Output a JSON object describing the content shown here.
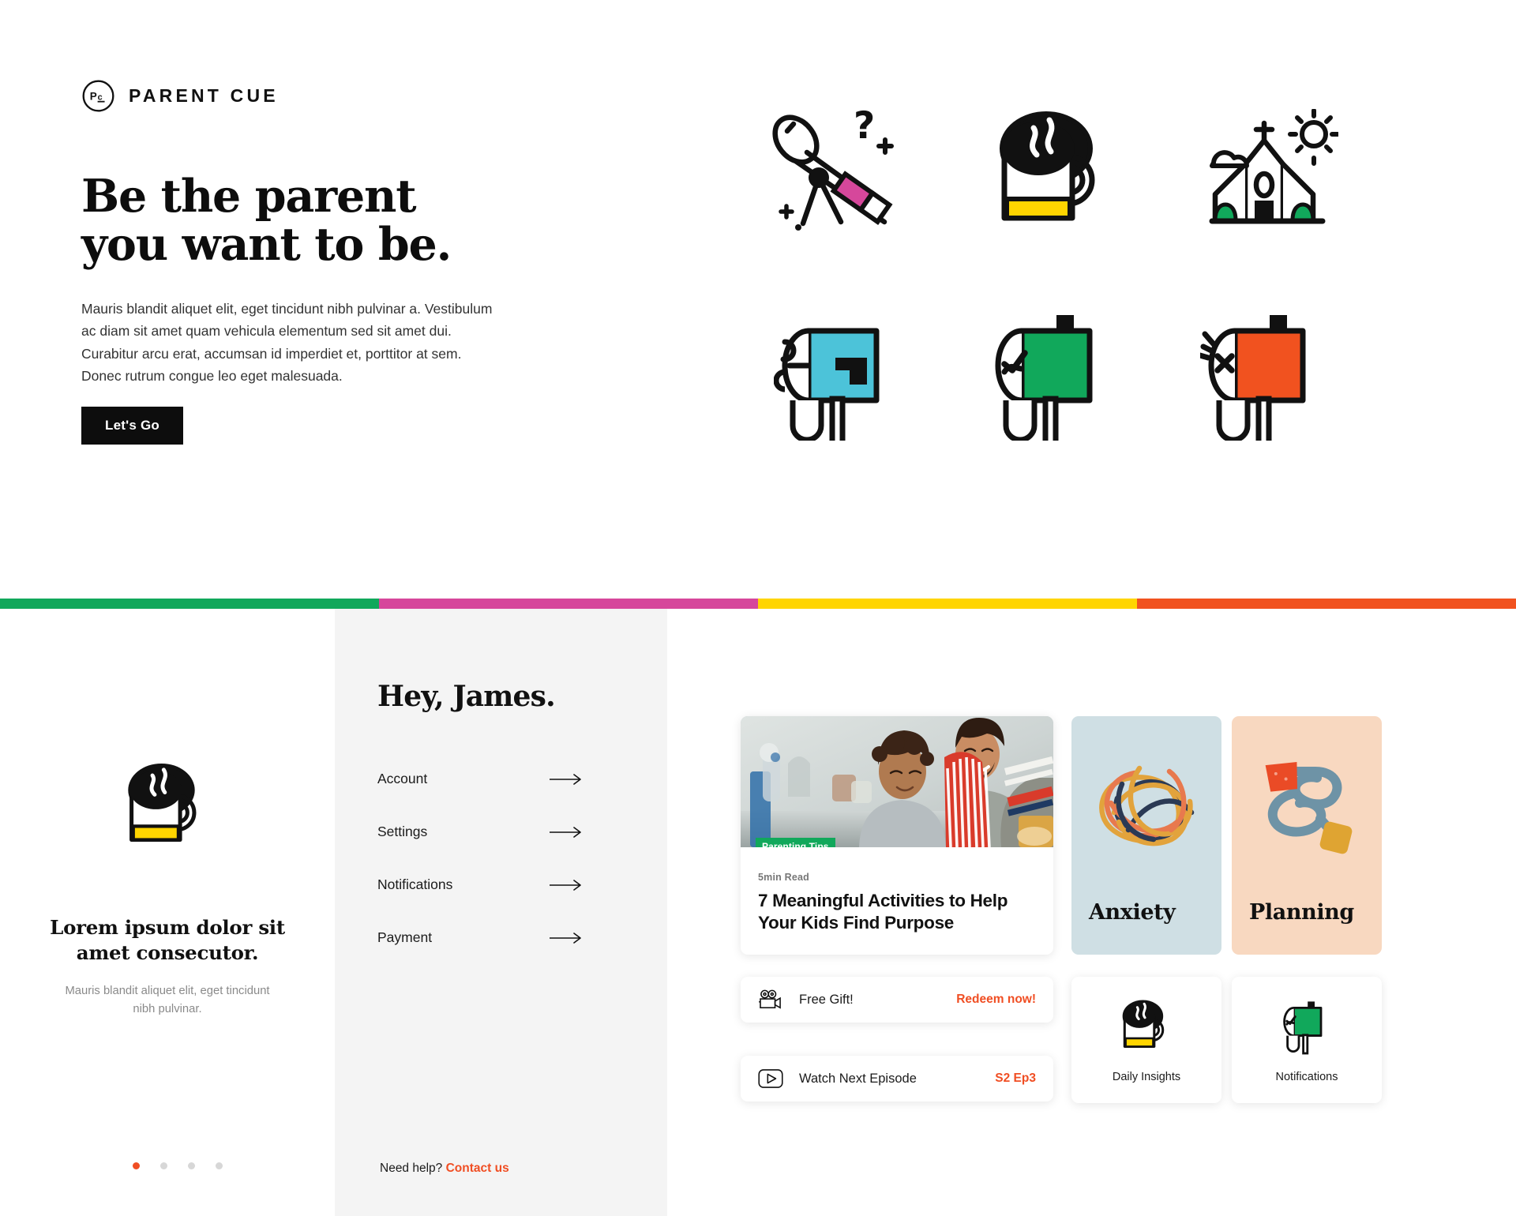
{
  "brand": {
    "logo_icon": "parent-cue-circle-logo",
    "name": "PARENT CUE",
    "accent_orange": "#f04e23",
    "accent_green": "#11a85b",
    "accent_yellow": "#ffd500",
    "accent_magenta": "#d6479b",
    "accent_cyan": "#4cc3d9"
  },
  "hero": {
    "title": "Be the parent\nyou want to be.",
    "title_line1": "Be the parent",
    "title_line2": "you want to be.",
    "paragraph": "Mauris blandit aliquet elit, eget tincidunt nibh pulvinar a. Vestibulum ac diam sit amet quam vehicula elementum sed sit amet dui. Curabitur arcu erat, accumsan id imperdiet et, porttitor at sem. Donec rutrum congue leo eget malesuada.",
    "cta_label": "Let's Go",
    "illustrations": [
      {
        "name": "telescope-icon",
        "label": "Telescope with question mark"
      },
      {
        "name": "coffee-mug-icon",
        "label": "Steaming coffee mug"
      },
      {
        "name": "church-icon",
        "label": "Church with sun and cloud"
      },
      {
        "name": "mailbox-open-icon",
        "label": "Open mailbox blue"
      },
      {
        "name": "mailbox-check-icon",
        "label": "Mailbox with checkmark green"
      },
      {
        "name": "mailbox-x-icon",
        "label": "Mailbox with X orange"
      }
    ]
  },
  "color_bar": [
    "#11a85b",
    "#d6479b",
    "#ffd500",
    "#f1521f"
  ],
  "promo": {
    "icon": "coffee-mug-icon",
    "title": "Lorem ipsum dolor sit amet consecutor.",
    "subtitle": "Mauris blandit aliquet elit, eget tincidunt nibh pulvinar.",
    "dots_total": 4,
    "dots_active_index": 0
  },
  "account": {
    "greeting": "Hey, James.",
    "nav_items": [
      {
        "label": "Account",
        "icon": "arrow-right-icon"
      },
      {
        "label": "Settings",
        "icon": "arrow-right-icon"
      },
      {
        "label": "Notifications",
        "icon": "arrow-right-icon"
      },
      {
        "label": "Payment",
        "icon": "arrow-right-icon"
      }
    ],
    "help_text": "Need help?",
    "help_link": "Contact us"
  },
  "dashboard": {
    "article": {
      "badge": "Parenting Tips",
      "read_time": "5min Read",
      "title": "7 Meaningful Activities to Help Your Kids Find Purpose",
      "photo_alt": "Father and child baking together in kitchen"
    },
    "rows": [
      {
        "icon": "film-camera-icon",
        "label": "Free Gift!",
        "action": "Redeem now!"
      },
      {
        "icon": "play-button-icon",
        "label": "Watch Next Episode",
        "action": "S2 Ep3"
      }
    ],
    "topics": [
      {
        "label": "Anxiety",
        "bg": "#cfdfe4",
        "art": "tangled-scribble-art"
      },
      {
        "label": "Planning",
        "bg": "#f8d8c0",
        "art": "knotted-string-art"
      }
    ],
    "tiles": [
      {
        "label": "Daily Insights",
        "icon": "coffee-mug-icon"
      },
      {
        "label": "Notifications",
        "icon": "mailbox-check-icon"
      }
    ]
  }
}
